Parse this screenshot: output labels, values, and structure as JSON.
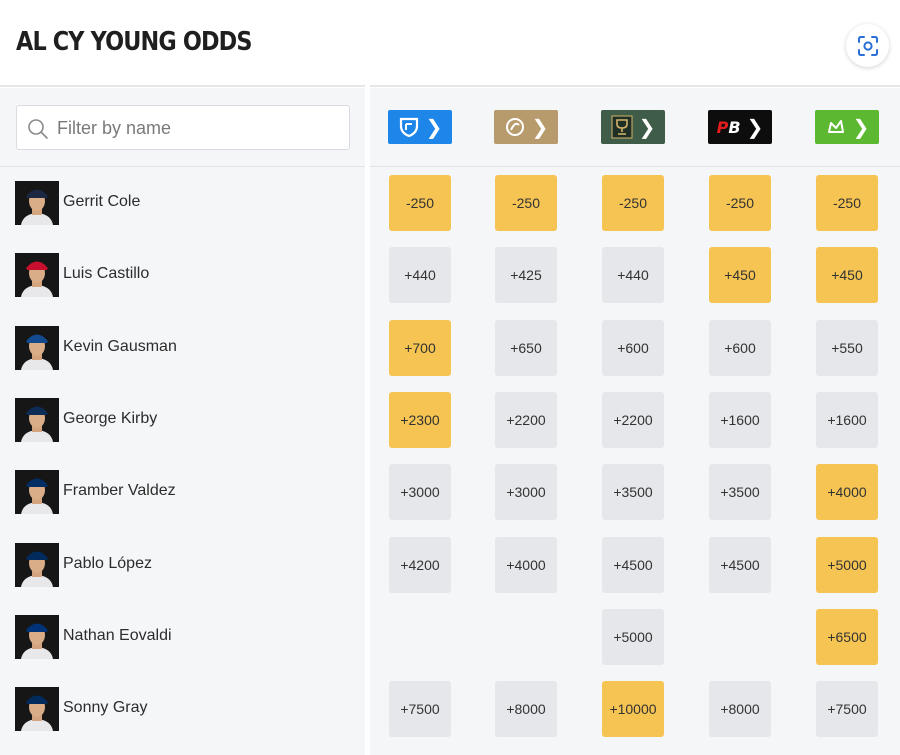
{
  "header": {
    "title": "AL CY YOUNG ODDS"
  },
  "filter": {
    "placeholder": "Filter by name",
    "value": ""
  },
  "sportsbooks": [
    {
      "name": "fanduel",
      "color": "#1e86e8"
    },
    {
      "name": "caesars",
      "color": "#b79b6c"
    },
    {
      "name": "betmgm",
      "color": "#3e5c48"
    },
    {
      "name": "pointsbet",
      "color": "#0d0d0d",
      "text": "PB"
    },
    {
      "name": "draftkings",
      "color": "#5cb830"
    }
  ],
  "players": [
    {
      "name": "Gerrit Cole",
      "team_color": "#1c2841",
      "odds": [
        {
          "v": "-250",
          "best": true
        },
        {
          "v": "-250",
          "best": true
        },
        {
          "v": "-250",
          "best": true
        },
        {
          "v": "-250",
          "best": true
        },
        {
          "v": "-250",
          "best": true
        }
      ]
    },
    {
      "name": "Luis Castillo",
      "team_color": "#c8102e",
      "odds": [
        {
          "v": "+440",
          "best": false
        },
        {
          "v": "+425",
          "best": false
        },
        {
          "v": "+440",
          "best": false
        },
        {
          "v": "+450",
          "best": true
        },
        {
          "v": "+450",
          "best": true
        }
      ]
    },
    {
      "name": "Kevin Gausman",
      "team_color": "#134a8e",
      "odds": [
        {
          "v": "+700",
          "best": true
        },
        {
          "v": "+650",
          "best": false
        },
        {
          "v": "+600",
          "best": false
        },
        {
          "v": "+600",
          "best": false
        },
        {
          "v": "+550",
          "best": false
        }
      ]
    },
    {
      "name": "George Kirby",
      "team_color": "#0c2c56",
      "odds": [
        {
          "v": "+2300",
          "best": true
        },
        {
          "v": "+2200",
          "best": false
        },
        {
          "v": "+2200",
          "best": false
        },
        {
          "v": "+1600",
          "best": false
        },
        {
          "v": "+1600",
          "best": false
        }
      ]
    },
    {
      "name": "Framber Valdez",
      "team_color": "#002d62",
      "odds": [
        {
          "v": "+3000",
          "best": false
        },
        {
          "v": "+3000",
          "best": false
        },
        {
          "v": "+3500",
          "best": false
        },
        {
          "v": "+3500",
          "best": false
        },
        {
          "v": "+4000",
          "best": true
        }
      ]
    },
    {
      "name": "Pablo López",
      "team_color": "#002b5c",
      "odds": [
        {
          "v": "+4200",
          "best": false
        },
        {
          "v": "+4000",
          "best": false
        },
        {
          "v": "+4500",
          "best": false
        },
        {
          "v": "+4500",
          "best": false
        },
        {
          "v": "+5000",
          "best": true
        }
      ]
    },
    {
      "name": "Nathan Eovaldi",
      "team_color": "#003278",
      "odds": [
        null,
        null,
        {
          "v": "+5000",
          "best": false
        },
        null,
        {
          "v": "+6500",
          "best": true
        }
      ]
    },
    {
      "name": "Sonny Gray",
      "team_color": "#002b5c",
      "odds": [
        {
          "v": "+7500",
          "best": false
        },
        {
          "v": "+8000",
          "best": false
        },
        {
          "v": "+10000",
          "best": true
        },
        {
          "v": "+8000",
          "best": false
        },
        {
          "v": "+7500",
          "best": false
        }
      ]
    }
  ],
  "colors": {
    "best_odds": "#f5c452",
    "regular_odds": "#e6e7ea",
    "panel_bg": "#f5f6f8"
  }
}
